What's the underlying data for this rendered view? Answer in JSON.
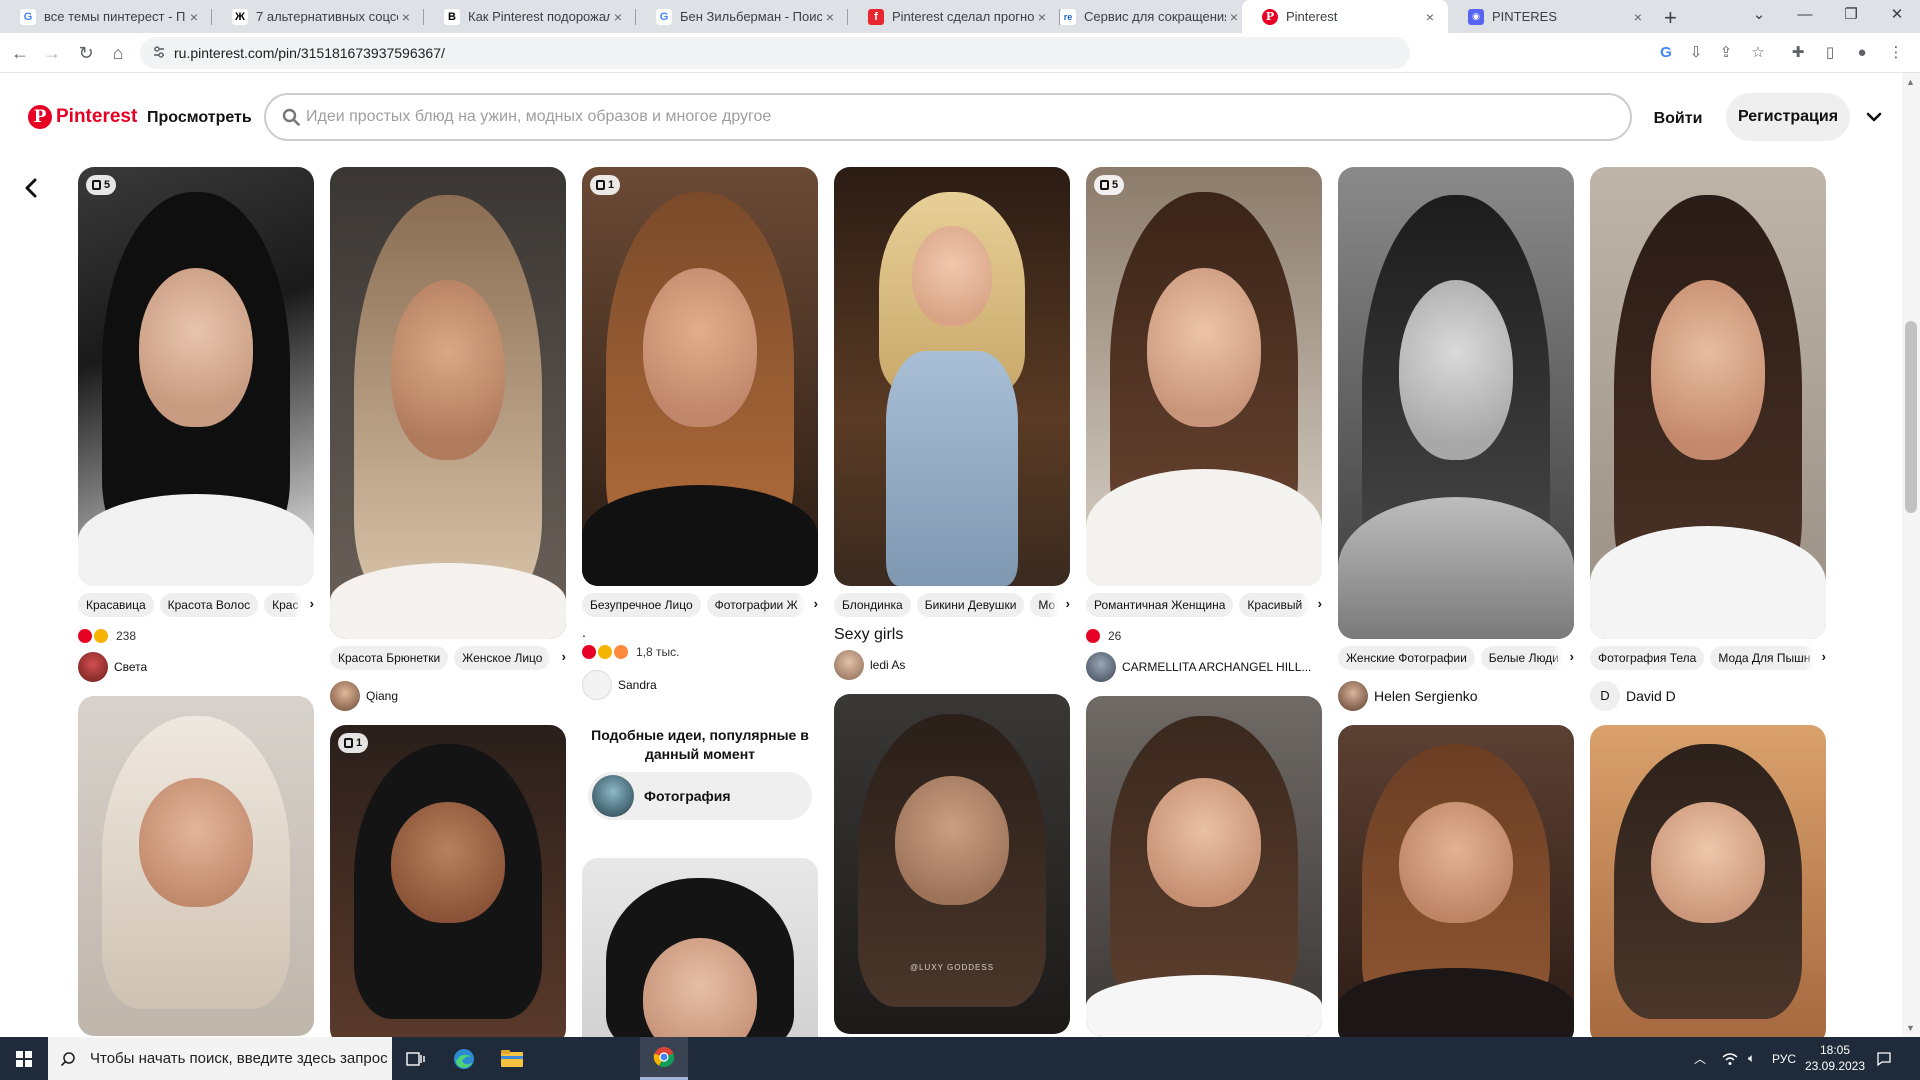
{
  "browser": {
    "tabs": [
      {
        "title": "все темы пинтерест - Пои",
        "icon": "google-icon",
        "active": false
      },
      {
        "title": "7 альтернативных соцсет",
        "icon": "zen-icon",
        "active": false
      },
      {
        "title": "Как Pinterest подорожал",
        "icon": "b-icon",
        "active": false
      },
      {
        "title": "Бен Зильберман - Поиск",
        "icon": "google-icon",
        "active": false
      },
      {
        "title": "Pinterest сделал прогноз",
        "icon": "f-icon",
        "active": false
      },
      {
        "title": "Сервис для сокращения",
        "icon": "re-icon",
        "active": false
      },
      {
        "title": "Pinterest",
        "icon": "pinterest-icon",
        "active": true
      },
      {
        "title": "PINTERES",
        "icon": "discord-icon",
        "active": false
      }
    ],
    "close_glyph": "×",
    "new_tab_glyph": "+",
    "url": "ru.pinterest.com/pin/315181673937596367/"
  },
  "header": {
    "logo_text": "Pinterest",
    "browse_label": "Просмотреть",
    "search_placeholder": "Идеи простых блюд на ужин, модных образов и многое другое",
    "search_value": "",
    "login_label": "Войти",
    "signup_label": "Регистрация"
  },
  "pins": {
    "p1": {
      "badge": "5",
      "tags": [
        "Красавица",
        "Красота Волос",
        "Крас"
      ],
      "reactions": [
        "heart",
        "wow"
      ],
      "count": "238",
      "author": "Света"
    },
    "p2": {
      "badge": "",
      "tags": [
        "Красота Брюнетки",
        "Женское Лицо"
      ],
      "author": "Qiang"
    },
    "p3": {
      "badge": "1"
    },
    "p4": {
      "badge": "1",
      "tags": [
        "Безупречное Лицо",
        "Фотографии Ж"
      ],
      "dot": ".",
      "reactions": [
        "heart",
        "wow",
        "haha"
      ],
      "count": "1,8 тыс.",
      "author": "Sandra"
    },
    "p6": {
      "badge": "",
      "tags": [
        "Блондинка",
        "Бикини Девушки",
        "Мо"
      ],
      "title": "Sexy girls",
      "author": "ledi As"
    },
    "p7": {
      "watermark": "@LUXY GODDESS"
    },
    "p8": {
      "badge": "5",
      "tags": [
        "Романтичная Женщина",
        "Красивый"
      ],
      "reactions": [
        "heart"
      ],
      "count": "26",
      "author": "CARMELLITA ARCHANGEL HILL..."
    },
    "p10": {
      "tags": [
        "Женские Фотографии",
        "Белые Люди"
      ],
      "author": "Helen Sergienko"
    },
    "p12": {
      "tags": [
        "Фотография Тела",
        "Мода Для Пышн"
      ],
      "author": "David D",
      "author_initial": "D"
    }
  },
  "ideas": {
    "heading": "Подобные идеи, популярные в данный момент",
    "chip_label": "Фотография"
  },
  "taskbar": {
    "search_placeholder": "Чтобы начать поиск, введите здесь запрос",
    "lang": "РУС",
    "time": "18:05",
    "date": "23.09.2023"
  }
}
